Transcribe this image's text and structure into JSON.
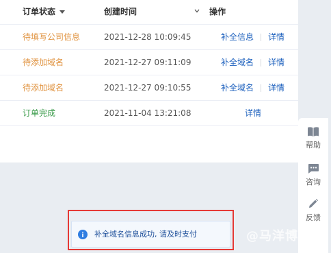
{
  "colors": {
    "status_pending": "#e0923e",
    "status_done": "#3a9b4a",
    "link": "#1b5fbd",
    "highlight_border": "#e53935",
    "toast_bg": "#f4f8fd",
    "toast_icon": "#2f7de1"
  },
  "table": {
    "headers": {
      "status": "订单状态",
      "created_time": "创建时间",
      "actions": "操作"
    },
    "rows": [
      {
        "status": "待填写公司信息",
        "status_type": "pending",
        "time": "2021-12-28 10:09:45",
        "actions": [
          "补全信息",
          "详情"
        ]
      },
      {
        "status": "待添加域名",
        "status_type": "pending",
        "time": "2021-12-27 09:11:09",
        "actions": [
          "补全域名",
          "详情"
        ]
      },
      {
        "status": "待添加域名",
        "status_type": "pending",
        "time": "2021-12-27 09:10:55",
        "actions": [
          "补全域名",
          "详情"
        ]
      },
      {
        "status": "订单完成",
        "status_type": "done",
        "time": "2021-11-04 13:21:08",
        "actions": [
          "详情"
        ]
      }
    ]
  },
  "side_toolbar": {
    "items": [
      {
        "icon": "book-icon",
        "label": "帮助"
      },
      {
        "icon": "chat-icon",
        "label": "咨询"
      },
      {
        "icon": "pencil-icon",
        "label": "反馈"
      }
    ]
  },
  "toast": {
    "icon": "info-icon",
    "message": "补全域名信息成功, 请及时支付"
  },
  "watermark": {
    "text": "@马洋博客"
  }
}
